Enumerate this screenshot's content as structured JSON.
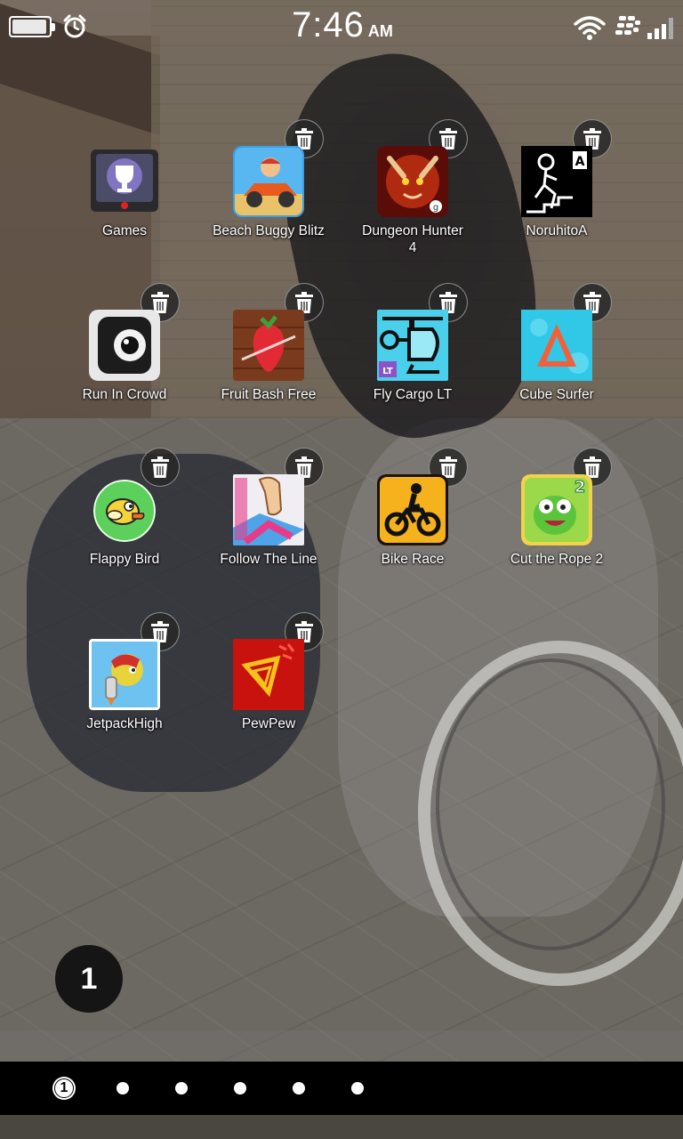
{
  "status_bar": {
    "time": "7:46",
    "ampm": "AM",
    "battery_level": 0.95,
    "icons": [
      "battery-icon",
      "alarm-clock-icon",
      "wifi-icon",
      "blackberry-icon",
      "signal-bars-icon"
    ]
  },
  "apps": [
    {
      "label": "Games",
      "icon": "games-hub-icon",
      "removable": false
    },
    {
      "label": "Beach Buggy Blitz",
      "icon": "beach-buggy-blitz-icon",
      "removable": true
    },
    {
      "label": "Dungeon Hunter 4",
      "icon": "dungeon-hunter-icon",
      "removable": true
    },
    {
      "label": "NoruhitoA",
      "icon": "noruhito-icon",
      "removable": true
    },
    {
      "label": "Run In Crowd",
      "icon": "run-in-crowd-icon",
      "removable": true
    },
    {
      "label": "Fruit Bash Free",
      "icon": "fruit-bash-icon",
      "removable": true
    },
    {
      "label": "Fly Cargo LT",
      "icon": "fly-cargo-icon",
      "removable": true
    },
    {
      "label": "Cube Surfer",
      "icon": "cube-surfer-icon",
      "removable": true
    },
    {
      "label": "Flappy Bird",
      "icon": "flappy-bird-icon",
      "removable": true
    },
    {
      "label": "Follow The Line",
      "icon": "follow-the-line-icon",
      "removable": true
    },
    {
      "label": "Bike Race",
      "icon": "bike-race-icon",
      "removable": true
    },
    {
      "label": "Cut the Rope 2",
      "icon": "cut-the-rope-icon",
      "removable": true
    },
    {
      "label": "JetpackHigh",
      "icon": "jetpack-high-icon",
      "removable": true
    },
    {
      "label": "PewPew",
      "icon": "pewpew-icon",
      "removable": true
    }
  ],
  "folder_badge": "1",
  "pager": {
    "active_label": "1",
    "page_count": 6,
    "active_index": 0
  }
}
